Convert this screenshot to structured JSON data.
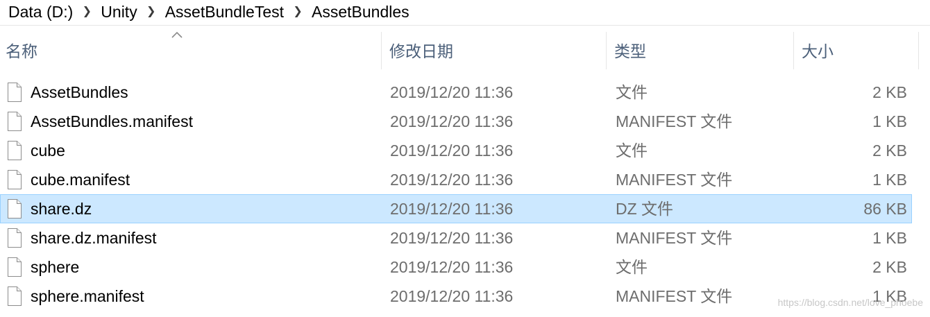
{
  "breadcrumb": [
    "Data (D:)",
    "Unity",
    "AssetBundleTest",
    "AssetBundles"
  ],
  "breadcrumb_separator_icon": "chevron-right-icon",
  "columns": {
    "name": "名称",
    "date": "修改日期",
    "type": "类型",
    "size": "大小"
  },
  "sort": {
    "column": "name",
    "direction": "ascending",
    "icon": "sort-up-icon"
  },
  "files": [
    {
      "name": "AssetBundles",
      "date": "2019/12/20 11:36",
      "type": "文件",
      "size": "2 KB",
      "selected": false
    },
    {
      "name": "AssetBundles.manifest",
      "date": "2019/12/20 11:36",
      "type": "MANIFEST 文件",
      "size": "1 KB",
      "selected": false
    },
    {
      "name": "cube",
      "date": "2019/12/20 11:36",
      "type": "文件",
      "size": "2 KB",
      "selected": false
    },
    {
      "name": "cube.manifest",
      "date": "2019/12/20 11:36",
      "type": "MANIFEST 文件",
      "size": "1 KB",
      "selected": false
    },
    {
      "name": "share.dz",
      "date": "2019/12/20 11:36",
      "type": "DZ 文件",
      "size": "86 KB",
      "selected": true
    },
    {
      "name": "share.dz.manifest",
      "date": "2019/12/20 11:36",
      "type": "MANIFEST 文件",
      "size": "1 KB",
      "selected": false
    },
    {
      "name": "sphere",
      "date": "2019/12/20 11:36",
      "type": "文件",
      "size": "2 KB",
      "selected": false
    },
    {
      "name": "sphere.manifest",
      "date": "2019/12/20 11:36",
      "type": "MANIFEST 文件",
      "size": "1 KB",
      "selected": false
    }
  ],
  "watermark": "https://blog.csdn.net/love_phoebe",
  "colors": {
    "selection_fill": "#cce8ff",
    "selection_border": "#99d1ff",
    "header_text": "#4c607a",
    "detail_text": "#6d6d6d"
  }
}
